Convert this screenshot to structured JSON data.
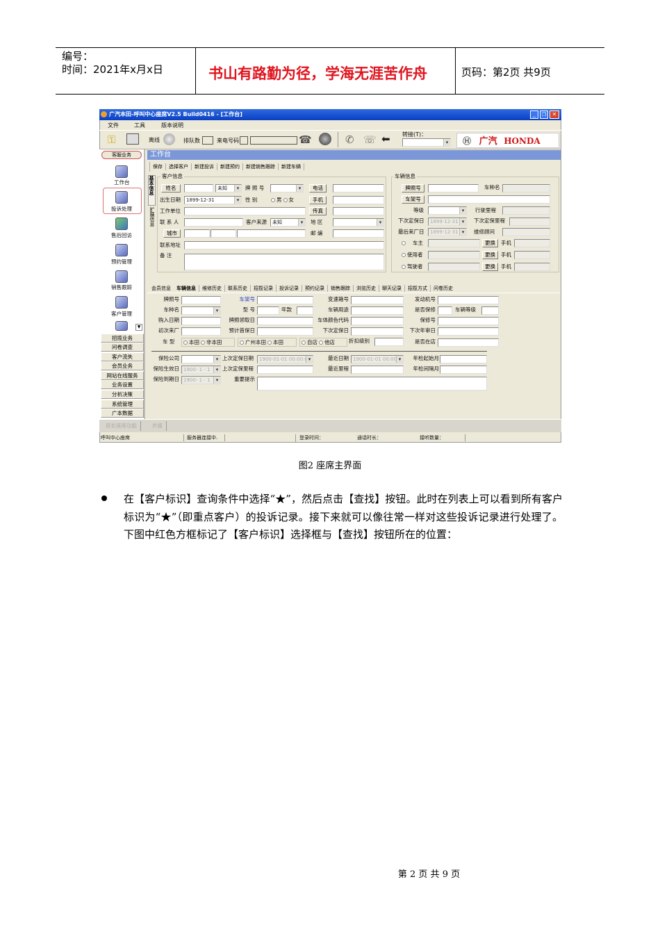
{
  "header": {
    "number_label": "编号：",
    "time_label": "时间：2021年x月x日",
    "motto": "书山有路勤为径，学海无涯苦作舟",
    "page_label": "页码：第2页  共9页"
  },
  "app": {
    "title": "广汽本田-呼叫中心座席V2.5 Build0416 - [工作台]",
    "menu": [
      "文件",
      "工具",
      "版本说明"
    ],
    "toolbar": {
      "status": "离线",
      "queue": "排队数",
      "caller": "来电号码",
      "transfer": "转接(T)：",
      "logo_cn": "广汽",
      "logo_en": "HONDA"
    },
    "sidebar": {
      "header": "客服业务",
      "icons": [
        "工作台",
        "投诉处理",
        "售后回访",
        "预约管理",
        "销售跟踪",
        "客户管理"
      ],
      "items": [
        "招揽业务",
        "问卷调查",
        "客户流失",
        "会员业务",
        "网站在线服务",
        "业务设置",
        "分析决策",
        "系统管理",
        "广本数据"
      ]
    },
    "panel_title": "工作台",
    "actions": [
      "保存",
      "选择客户",
      "新建投诉",
      "新建预约",
      "新建销售跟踪",
      "新建车辆"
    ],
    "vtabs": [
      "基本信息",
      "扩展信息"
    ],
    "customer": {
      "group": "客户信息",
      "name": "姓名",
      "unknown": "未知",
      "plate": "牌 照 号",
      "phone": "电话",
      "birth": "出生日期",
      "birth_val": "1899-12-31",
      "gender": "性    别",
      "male": "男",
      "female": "女",
      "mobile": "手机",
      "work": "工作单位",
      "fax": "传真",
      "contact": "联 系 人",
      "source": "客户来源",
      "source_val": "未知",
      "area": "地    区",
      "city": "城市",
      "zip": "邮    编",
      "address": "联系地址",
      "remark": "备    注"
    },
    "vehicle": {
      "group": "车辆信息",
      "plate": "牌照号",
      "model": "车种名",
      "vin": "车架号",
      "grade": "等级",
      "mileage": "行驶里程",
      "next_date": "下次定保日",
      "next_date_val": "1899-12-31",
      "next_mileage": "下次定保里程",
      "last_visit": "最后来厂日",
      "last_visit_val": "1899-12-31",
      "advisor": "维修顾问",
      "owner": "车主",
      "user": "使用者",
      "driver": "驾驶者",
      "change": "更换",
      "mobile": "手机"
    },
    "tabs": [
      "会员信息",
      "车辆信息",
      "维修历史",
      "联系历史",
      "招揽记录",
      "投诉记录",
      "预约记录",
      "销售跟踪",
      "浏览历史",
      "聊天记录",
      "招揽方式",
      "问卷历史"
    ],
    "detail": {
      "plate": "牌照号",
      "vin": "车架号",
      "gearbox": "变速箱号",
      "engine": "发动机号",
      "model": "车种名",
      "type": "型    号",
      "year": "年款",
      "usage": "车辆用途",
      "warranty": "是否保修",
      "level": "车辆等级",
      "buy_date": "购入日期",
      "plate_date": "牌照领取日",
      "color": "车体颜色代码",
      "warranty_no": "保修号",
      "first_visit": "初次来厂",
      "first_service": "预计首保日",
      "next_service": "下次定保日",
      "next_inspect": "下次年审日",
      "car_type": "车    型",
      "honda": "本田",
      "non_honda": "非本田",
      "gz_honda": "广州本田",
      "honda2": "本田",
      "own_store": "自店",
      "other_store": "他店",
      "discount": "折扣级别",
      "in_store": "是否在店",
      "insurer": "保险公司",
      "last_service_date": "上次定保日期",
      "date_val": "1900-01-01 00:00:0",
      "recent_date": "最近日期",
      "recent_date_val": "1900-01-01 00:00",
      "inspect_start": "年检起始月",
      "ins_start": "保险生效日",
      "ins_date_val": "1900- 1 - 1",
      "last_service_mileage": "上次定保里程",
      "recent_mileage": "最近里程",
      "inspect_interval": "年检间隔月",
      "ins_end": "保险到期日",
      "notice": "重要提示"
    },
    "bottom": [
      "班长座席功能",
      "外拨"
    ],
    "status": [
      "呼叫中心座席",
      "服务器连接中.",
      "登录时间：",
      "通话时长：",
      "接听数量："
    ]
  },
  "caption": "图2 座席主界面",
  "paragraph": "在【客户标识】查询条件中选择“★”，然后点击【查找】按钮。此时在列表上可以看到所有客户标识为“★”（即重点客户）的投诉记录。接下来就可以像往常一样对这些投诉记录进行处理了。下图中红色方框标记了【客户标识】选择框与【查找】按钮所在的位置：",
  "footer": "第 2 页 共 9 页"
}
